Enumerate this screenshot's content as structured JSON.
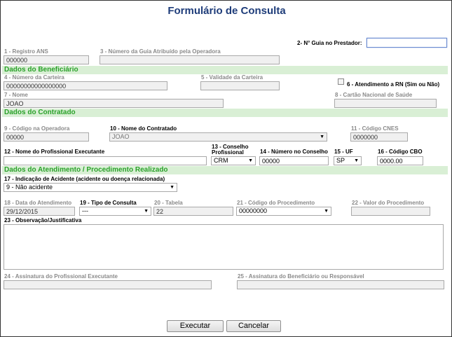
{
  "title": "Formulário de Consulta",
  "guia_prestador": {
    "label": "2- N° Guia no Prestador:",
    "value": ""
  },
  "registro_ans": {
    "label": "1 - Registro ANS",
    "value": "000000"
  },
  "guia_operadora": {
    "label": "3 - Número da Guia Atribuído pela Operadora",
    "value": ""
  },
  "sections": {
    "beneficiario": "Dados do Beneficiário",
    "contratado": "Dados do Contratado",
    "atendimento": "Dados do Atendimento / Procedimento Realizado"
  },
  "numero_carteira": {
    "label": "4 - Número da Carteira",
    "value": "00000000000000000"
  },
  "validade_carteira": {
    "label": "5 - Validade da Carteira",
    "value": ""
  },
  "atendimento_rn": {
    "label": "6 - Atendimento a RN (Sim ou Não)",
    "checked": false
  },
  "nome": {
    "label": "7 - Nome",
    "value": "JOAO"
  },
  "cartao_nacional": {
    "label": "8 - Cartão Nacional de  Saúde",
    "value": ""
  },
  "codigo_operadora": {
    "label": "9 - Código na Operadora",
    "value": "00000"
  },
  "nome_contratado": {
    "label": "10 - Nome do Contratado",
    "value": "JOAO"
  },
  "codigo_cnes": {
    "label": "11 - Código CNES",
    "value": "0000000"
  },
  "profissional_executante": {
    "label": "12 - Nome do Profissional Executante",
    "value": ""
  },
  "conselho_profissional": {
    "label_line1": "13 - Conselho",
    "label_line2": "Profissional",
    "value": "CRM"
  },
  "numero_conselho": {
    "label": "14 - Número no Conselho",
    "value": "00000"
  },
  "uf": {
    "label": "15 - UF",
    "value": "SP"
  },
  "codigo_cbo": {
    "label": "16 - Código CBO",
    "value": "0000.00"
  },
  "indicacao_acidente": {
    "label": "17 - Indicação de Acidente (acidente ou doença relacionada)",
    "value": "9 - Não acidente"
  },
  "data_atendimento": {
    "label": "18 - Data do Atendimento",
    "value": "29/12/2015"
  },
  "tipo_consulta": {
    "label": "19 - Tipo de Consulta",
    "value": "---"
  },
  "tabela": {
    "label": "20 - Tabela",
    "value": "22"
  },
  "codigo_procedimento": {
    "label": "21 - Código do Procedimento",
    "value": "00000000"
  },
  "valor_procedimento": {
    "label": "22 - Valor do Procedimento",
    "value": ""
  },
  "observacao": {
    "label": "23 - Observação/Justificativa",
    "value": ""
  },
  "assinatura_profissional": {
    "label": "24 - Assinatura do Profissional Executante",
    "value": ""
  },
  "assinatura_beneficiario": {
    "label": "25 - Assinatura do Beneficiário ou Responsável",
    "value": ""
  },
  "buttons": {
    "executar": "Executar",
    "cancelar": "Cancelar"
  },
  "icons": {
    "dropdown": "chevron-down-icon"
  },
  "colors": {
    "title": "#1f3d7a",
    "section_bg": "#d9efd5",
    "section_text": "#2aa12a"
  }
}
